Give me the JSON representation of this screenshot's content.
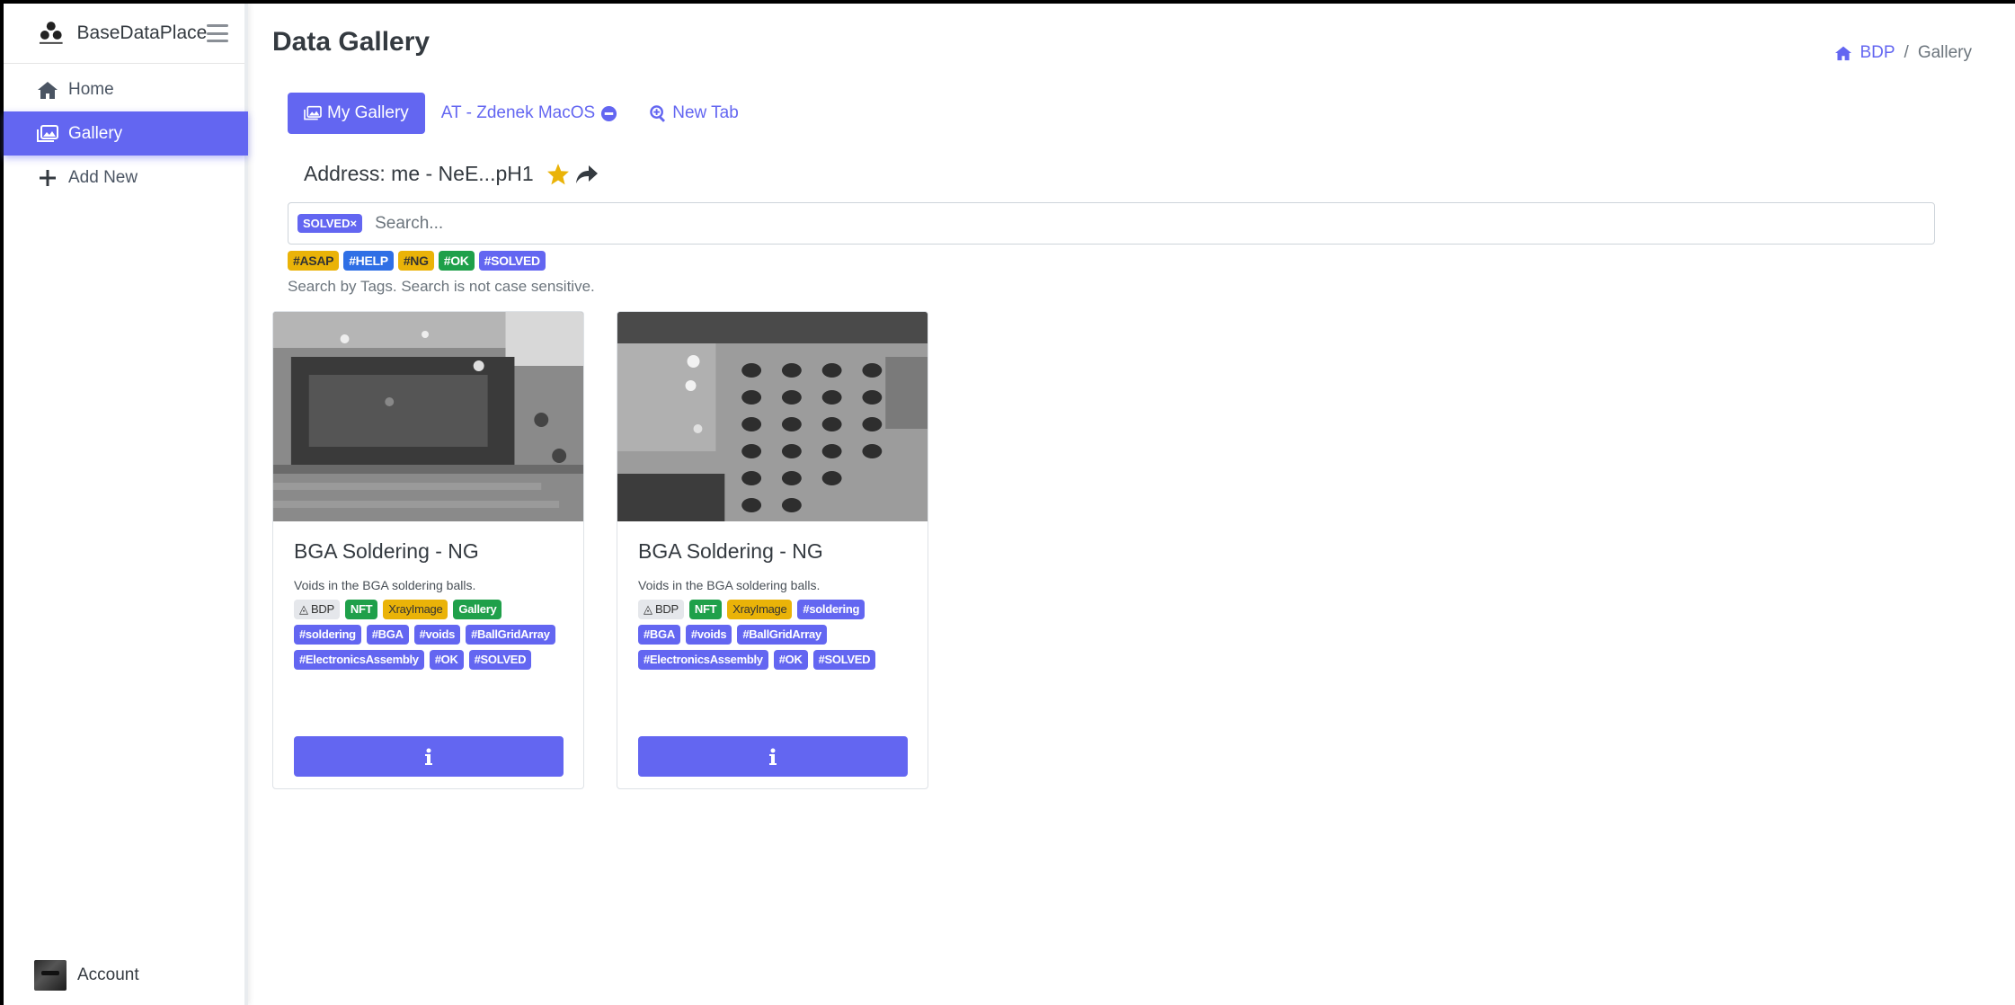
{
  "app": {
    "brand": "BaseDataPlace",
    "page_title": "Data Gallery"
  },
  "sidebar": {
    "items": [
      {
        "label": "Home",
        "icon": "home-icon"
      },
      {
        "label": "Gallery",
        "icon": "gallery-icon",
        "active": true
      },
      {
        "label": "Add New",
        "icon": "plus-icon"
      }
    ],
    "account_label": "Account"
  },
  "breadcrumb": {
    "home": "BDP",
    "separator": "/",
    "current": "Gallery"
  },
  "tabs": [
    {
      "label": "My Gallery",
      "active": true
    },
    {
      "label": "AT - Zdenek MacOS"
    },
    {
      "label": "New Tab"
    }
  ],
  "address": {
    "label": "Address: me - NeE...pH1"
  },
  "search": {
    "active_chip": "SOLVED×",
    "placeholder": "Search...",
    "value": ""
  },
  "tag_filters": [
    "#ASAP",
    "#HELP",
    "#NG",
    "#OK",
    "#SOLVED"
  ],
  "hint": "Search by Tags. Search is not case sensitive.",
  "cards": [
    {
      "title": "BGA Soldering - NG",
      "text": "Voids in the BGA soldering balls.",
      "tags": [
        "BDP",
        "NFT",
        "XrayImage",
        "Gallery",
        "#soldering",
        "#BGA",
        "#voids",
        "#BallGridArray",
        "#ElectronicsAssembly",
        "#OK",
        "#SOLVED"
      ]
    },
    {
      "title": "BGA Soldering - NG",
      "text": "Voids in the BGA soldering balls.",
      "tags": [
        "BDP",
        "NFT",
        "XrayImage",
        "#soldering",
        "#BGA",
        "#voids",
        "#BallGridArray",
        "#ElectronicsAssembly",
        "#OK",
        "#SOLVED"
      ]
    }
  ],
  "colors": {
    "accent": "#6366f1",
    "yellow": "#eab308",
    "blue": "#2f6fe5",
    "green": "#1fa04a"
  }
}
